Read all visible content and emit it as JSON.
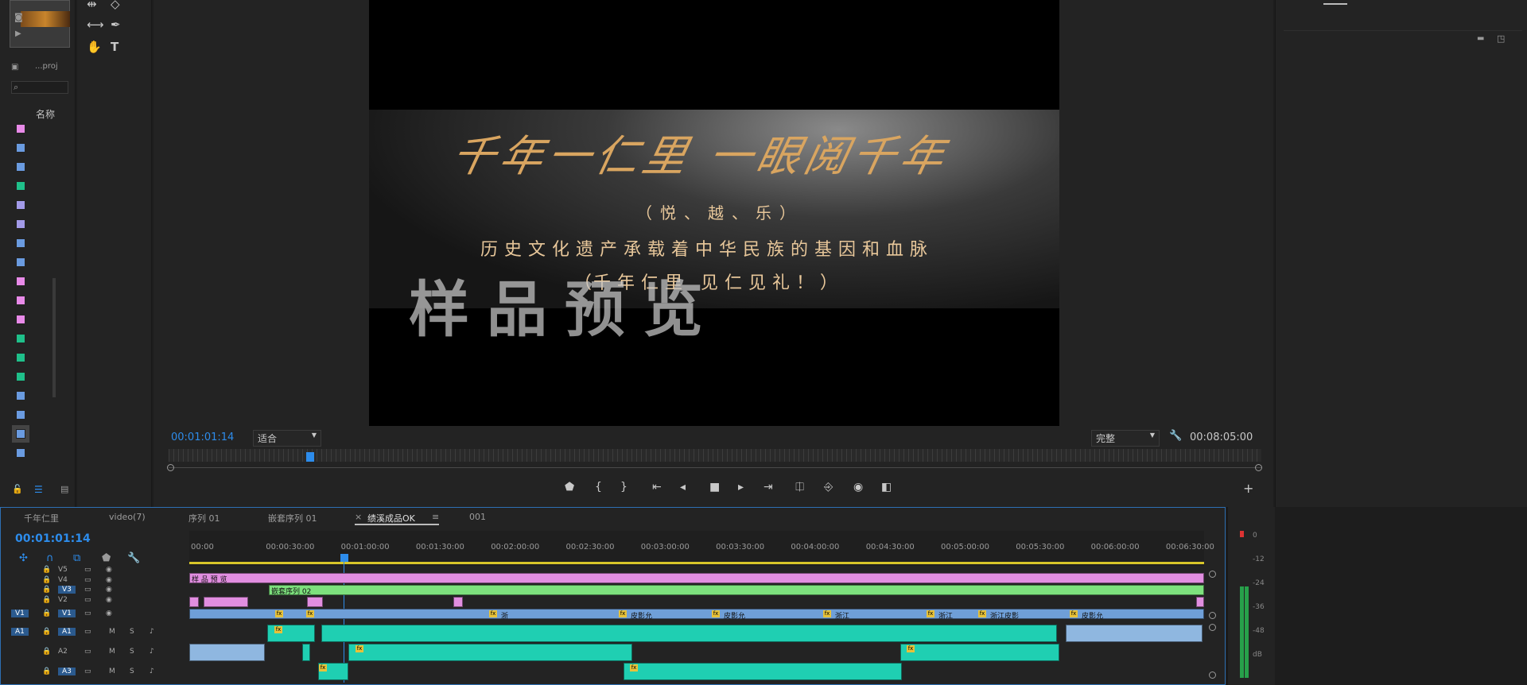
{
  "project": {
    "name": "...proj",
    "column_name": "名称",
    "clip_colors": [
      "#e88ae8",
      "#6a9be0",
      "#6a9be0",
      "#1fc08a",
      "#a29ae8",
      "#a29ae8",
      "#6a9be0",
      "#6a9be0",
      "#e88ae8",
      "#e88ae8",
      "#e88ae8",
      "#1fc08a",
      "#1fc08a",
      "#1fc08a",
      "#6a9be0",
      "#6a9be0",
      "#6a9be0",
      "#6a9be0"
    ]
  },
  "monitor": {
    "video_title": "千年一仁里 一眼阅千年",
    "video_line2": "（悦、越、乐）",
    "video_line3": "历史文化遗产承载着中华民族的基因和血脉",
    "video_line4": "千年仁里  见仁见礼！）",
    "video_line4_prefix": "（",
    "watermark": "样品预览",
    "current_time": "00:01:01:14",
    "fit_select": "适合",
    "quality_select": "完整",
    "duration": "00:08:05:00",
    "playhead_fraction": 0.126
  },
  "timeline": {
    "tabs": [
      "千年仁里",
      "video(7)",
      "序列 01",
      "嵌套序列 01",
      "绩溪成品OK",
      "001"
    ],
    "active_tab": "绩溪成品OK",
    "close_symbol": "×",
    "menu_symbol": "≡",
    "timecode": "00:01:01:14",
    "ruler_labels": [
      "00:00",
      "00:00:30:00",
      "00:01:00:00",
      "00:01:30:00",
      "00:02:00:00",
      "00:02:30:00",
      "00:03:00:00",
      "00:03:30:00",
      "00:04:00:00",
      "00:04:30:00",
      "00:05:00:00",
      "00:05:30:00",
      "00:06:00:00",
      "00:06:30:00"
    ],
    "video_tracks": [
      "V5",
      "V4",
      "V3",
      "V2",
      "V1"
    ],
    "audio_tracks": [
      "A1",
      "A2",
      "A3"
    ],
    "src_v": "V1",
    "src_a": "A1",
    "m_label": "M",
    "s_label": "S",
    "clip_v4": "样 品 预 览",
    "clip_v3": "嵌套序列 02",
    "v1_clip_labels": [
      "浙",
      "皮影允",
      "皮影允",
      "浙江",
      "浙江",
      "浙江皮影",
      "皮影允"
    ],
    "fx_label": "fx"
  },
  "meter": {
    "labels": [
      "0",
      "-12",
      "-24",
      "-36",
      "-48",
      "dB"
    ]
  },
  "colors": {
    "accent": "#2d8ceb",
    "pink_clip": "#e18ee0",
    "green_clip": "#7de07d",
    "blue_clip": "#6f9fd8",
    "teal_audio": "#1fcfb2"
  }
}
